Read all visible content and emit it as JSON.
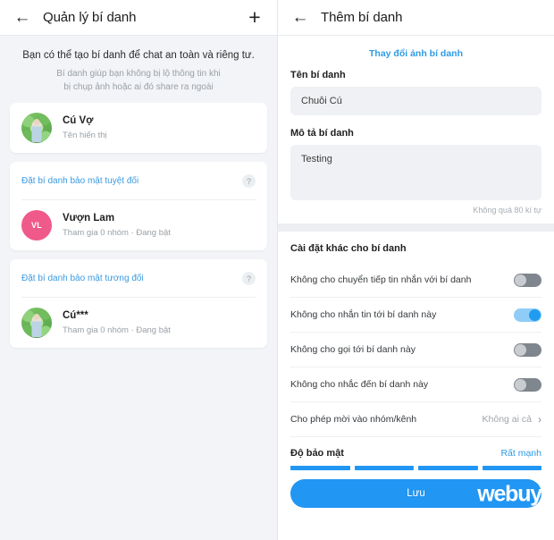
{
  "left": {
    "appbar": {
      "back_icon": "back-arrow-icon",
      "title": "Quản lý bí danh",
      "add_icon": "plus-icon"
    },
    "intro": {
      "title": "Bạn có thể tạo bí danh để chat an toàn và riêng tư.",
      "subtitle_line1": "Bí danh giúp bạn không bị lộ thông tin khi",
      "subtitle_line2": "bị chụp ảnh hoặc ai đó share ra ngoài"
    },
    "primary_alias": {
      "name": "Cú Vợ",
      "meta": "Tên hiển thị",
      "avatar_type": "photo"
    },
    "sections": [
      {
        "link": "Đặt bí danh bảo mật tuyệt đối",
        "help_icon": "help-question-icon",
        "help_label": "?",
        "alias": {
          "name": "Vượn Lam",
          "meta": "Tham gia 0 nhóm · Đang bật",
          "avatar_type": "initials",
          "initials": "VL",
          "avatar_color": "#ef5a8a"
        }
      },
      {
        "link": "Đặt bí danh bảo mật tương đối",
        "help_icon": "help-question-icon",
        "help_label": "?",
        "alias": {
          "name": "Cú***",
          "meta": "Tham gia 0 nhóm · Đang bật",
          "avatar_type": "photo"
        }
      }
    ]
  },
  "right": {
    "appbar": {
      "back_icon": "back-arrow-icon",
      "title": "Thêm bí danh"
    },
    "change_photo": "Thay đổi ảnh bí danh",
    "name_field": {
      "label": "Tên bí danh",
      "value": "Chuỗi Cú",
      "placeholder": "Tên bí danh"
    },
    "desc_field": {
      "label": "Mô tả bí danh",
      "value": "Testing",
      "placeholder": "Mô tả bí danh",
      "hint": "Không quá 80 kí tự"
    },
    "settings_title": "Cài đặt khác cho bí danh",
    "settings": [
      {
        "label": "Không cho chuyển tiếp tin nhắn với bí danh",
        "type": "toggle",
        "state": "off"
      },
      {
        "label": "Không cho nhắn tin tới bí danh này",
        "type": "toggle",
        "state": "on"
      },
      {
        "label": "Không cho gọi tới bí danh này",
        "type": "toggle",
        "state": "off"
      },
      {
        "label": "Không cho nhắc đến bí danh này",
        "type": "toggle",
        "state": "off"
      },
      {
        "label": "Cho phép mời vào nhóm/kênh",
        "type": "value",
        "value": "Không ai cả",
        "chevron": "chevron-right-icon"
      }
    ],
    "strength": {
      "title": "Độ bảo mật",
      "value": "Rất mạnh",
      "segments": 4,
      "filled": 4,
      "color": "#2196f3"
    },
    "save_label": "Lưu",
    "watermark": "webuy"
  }
}
